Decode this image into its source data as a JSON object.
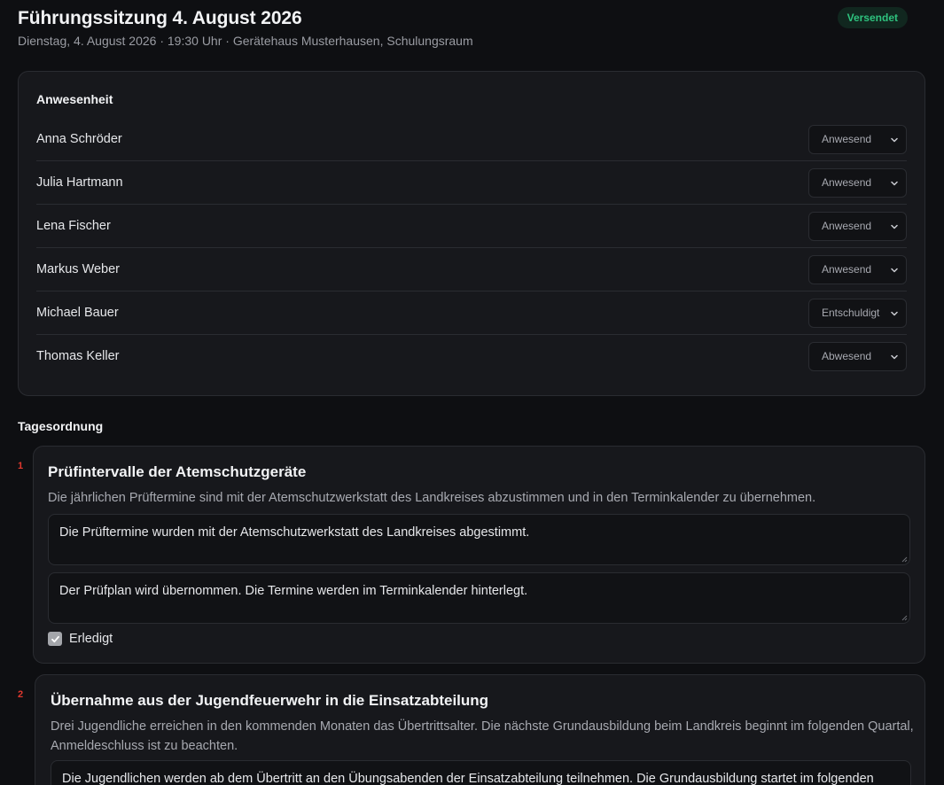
{
  "header": {
    "title": "Führungssitzung 4. August 2026",
    "subtitle": "Dienstag, 4. August 2026 · 19:30 Uhr · Gerätehaus Musterhausen, Schulungsraum",
    "status_badge": "Versendet",
    "status_color": "#2ec27e"
  },
  "attendance": {
    "title": "Anwesenheit",
    "rows": [
      {
        "name": "Anna Schröder",
        "status": "Anwesend"
      },
      {
        "name": "Julia Hartmann",
        "status": "Anwesend"
      },
      {
        "name": "Lena Fischer",
        "status": "Anwesend"
      },
      {
        "name": "Markus Weber",
        "status": "Anwesend"
      },
      {
        "name": "Michael Bauer",
        "status": "Entschuldigt"
      },
      {
        "name": "Thomas Keller",
        "status": "Abwesend"
      }
    ]
  },
  "agenda": {
    "title": "Tagesordnung",
    "items": [
      {
        "number": "1",
        "title": "Prüfintervalle der Atemschutzgeräte",
        "description": "Die jährlichen Prüftermine sind mit der Atemschutzwerkstatt des Landkreises abzustimmen und in den Terminkalender zu übernehmen.",
        "discussion": "Die Prüftermine wurden mit der Atemschutzwerkstatt des Landkreises abgestimmt.",
        "resolution": "Der Prüfplan wird übernommen. Die Termine werden im Terminkalender hinterlegt.",
        "done_label": "Erledigt",
        "done": true
      },
      {
        "number": "2",
        "title": "Übernahme aus der Jugendfeuerwehr in die Einsatzabteilung",
        "description": "Drei Jugendliche erreichen in den kommenden Monaten das Übertrittsalter. Die nächste Grundausbildung beim Landkreis beginnt im folgenden Quartal, Anmeldeschluss ist zu beachten.",
        "discussion": "Die Jugendlichen werden ab dem Übertritt an den Übungsabenden der Einsatzabteilung teilnehmen. Die Grundausbildung startet im folgenden"
      }
    ]
  },
  "colors": {
    "accent_red": "#e0382e",
    "card_bg": "#17181c",
    "page_bg": "#0e0f12"
  }
}
